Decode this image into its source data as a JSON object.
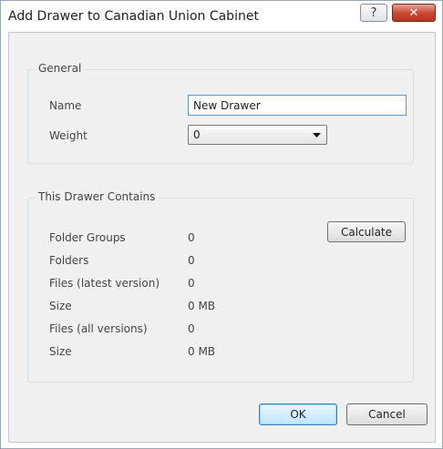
{
  "window": {
    "title": "Add Drawer to Canadian Union Cabinet",
    "help_glyph": "?",
    "close_glyph": "✕"
  },
  "general": {
    "legend": "General",
    "name_label": "Name",
    "name_value": "New Drawer",
    "weight_label": "Weight",
    "weight_value": "0"
  },
  "contents": {
    "legend": "This Drawer Contains",
    "calculate_label": "Calculate",
    "rows": [
      {
        "label": "Folder Groups",
        "value": "0"
      },
      {
        "label": "Folders",
        "value": "0"
      },
      {
        "label": "Files (latest version)",
        "value": "0"
      },
      {
        "label": "Size",
        "value": "0 MB"
      },
      {
        "label": "Files (all versions)",
        "value": "0"
      },
      {
        "label": "Size",
        "value": "0 MB"
      }
    ]
  },
  "buttons": {
    "ok_label": "OK",
    "cancel_label": "Cancel"
  },
  "colors": {
    "close_button": "#c9452f",
    "input_focus_border": "#5b9bd5",
    "dialog_background": "#f0f0f0"
  }
}
